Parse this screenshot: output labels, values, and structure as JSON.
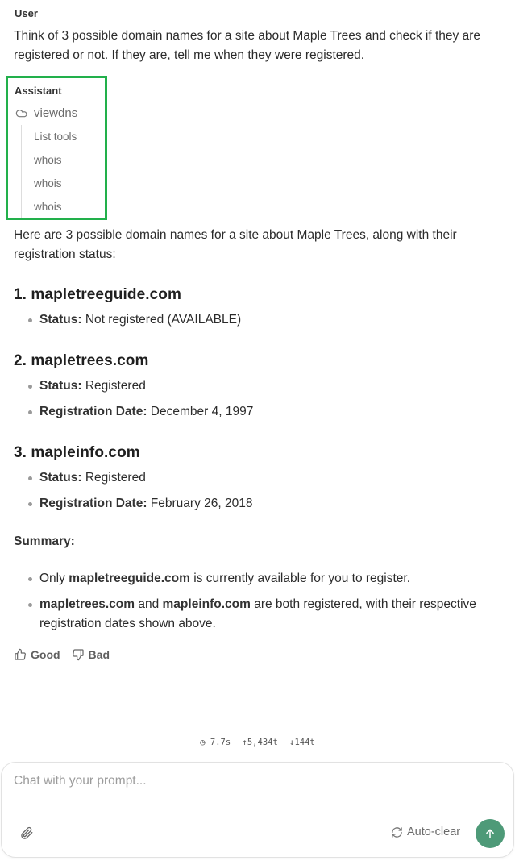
{
  "conversation": {
    "user": {
      "label": "User",
      "message": "Think of 3 possible domain names for a site about Maple Trees and check if they are registered or not.  If they are, tell me when they were registered."
    },
    "assistant": {
      "label": "Assistant",
      "tool_server": "viewdns",
      "tool_server_icon": "cloud-icon",
      "tool_calls": [
        "List tools",
        "whois",
        "whois",
        "whois"
      ],
      "intro": "Here are 3 possible domain names for a site about Maple Trees, along with their registration status:",
      "domains": [
        {
          "heading": "1. mapletreeguide.com",
          "items": [
            {
              "label": "Status:",
              "value": " Not registered (AVAILABLE)"
            }
          ]
        },
        {
          "heading": "2. mapletrees.com",
          "items": [
            {
              "label": "Status:",
              "value": " Registered"
            },
            {
              "label": "Registration Date:",
              "value": " December 4, 1997"
            }
          ]
        },
        {
          "heading": "3. mapleinfo.com",
          "items": [
            {
              "label": "Status:",
              "value": " Registered"
            },
            {
              "label": "Registration Date:",
              "value": " February 26, 2018"
            }
          ]
        }
      ],
      "summary_title": "Summary:",
      "summary": {
        "item1": {
          "pre": "Only ",
          "bold": "mapletreeguide.com",
          "post": " is currently available for you to register."
        },
        "item2": {
          "bold1": "mapletrees.com",
          "mid": " and ",
          "bold2": "mapleinfo.com",
          "post": " are both registered, with their respective registration dates shown above."
        }
      }
    },
    "feedback": {
      "good_label": "Good",
      "bad_label": "Bad"
    },
    "stats": {
      "time": "7.7s",
      "tokens_up": "5,434t",
      "tokens_down": "144t"
    }
  },
  "composer": {
    "placeholder": "Chat with your prompt...",
    "value": "",
    "autoclear_label": "Auto-clear",
    "send_color": "#4e9a78"
  },
  "colors": {
    "highlight_border": "#22b04b",
    "text": "#2b2b2b",
    "muted": "#6a6a6a"
  }
}
